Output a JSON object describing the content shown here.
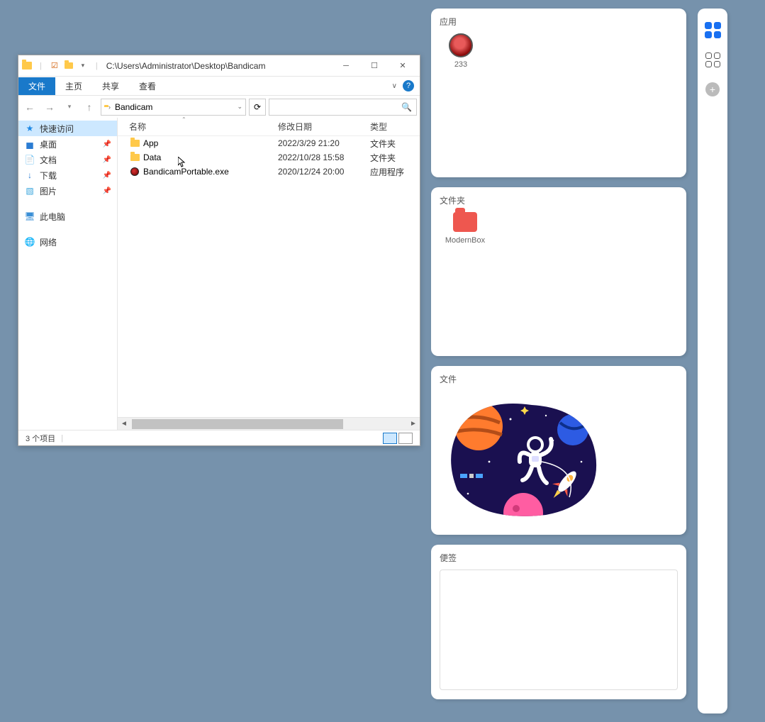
{
  "explorer": {
    "title_path": "C:\\Users\\Administrator\\Desktop\\Bandicam",
    "ribbon": {
      "file": "文件",
      "home": "主页",
      "share": "共享",
      "view": "查看"
    },
    "breadcrumb": "Bandicam",
    "nav": {
      "quick_access": "快速访问",
      "desktop": "桌面",
      "documents": "文档",
      "downloads": "下载",
      "pictures": "图片",
      "this_pc": "此电脑",
      "network": "网络"
    },
    "columns": {
      "name": "名称",
      "date": "修改日期",
      "type": "类型"
    },
    "files": [
      {
        "name": "App",
        "date": "2022/3/29 21:20",
        "type": "文件夹",
        "icon": "folder"
      },
      {
        "name": "Data",
        "date": "2022/10/28 15:58",
        "type": "文件夹",
        "icon": "folder"
      },
      {
        "name": "BandicamPortable.exe",
        "date": "2020/12/24 20:00",
        "type": "应用程序",
        "icon": "exe"
      }
    ],
    "status": "3 个项目"
  },
  "widgets": {
    "apps": {
      "title": "应用",
      "items": [
        {
          "label": "233"
        }
      ]
    },
    "folders": {
      "title": "文件夹",
      "items": [
        {
          "label": "ModernBox"
        }
      ]
    },
    "files": {
      "title": "文件"
    },
    "notes": {
      "title": "便签"
    }
  }
}
